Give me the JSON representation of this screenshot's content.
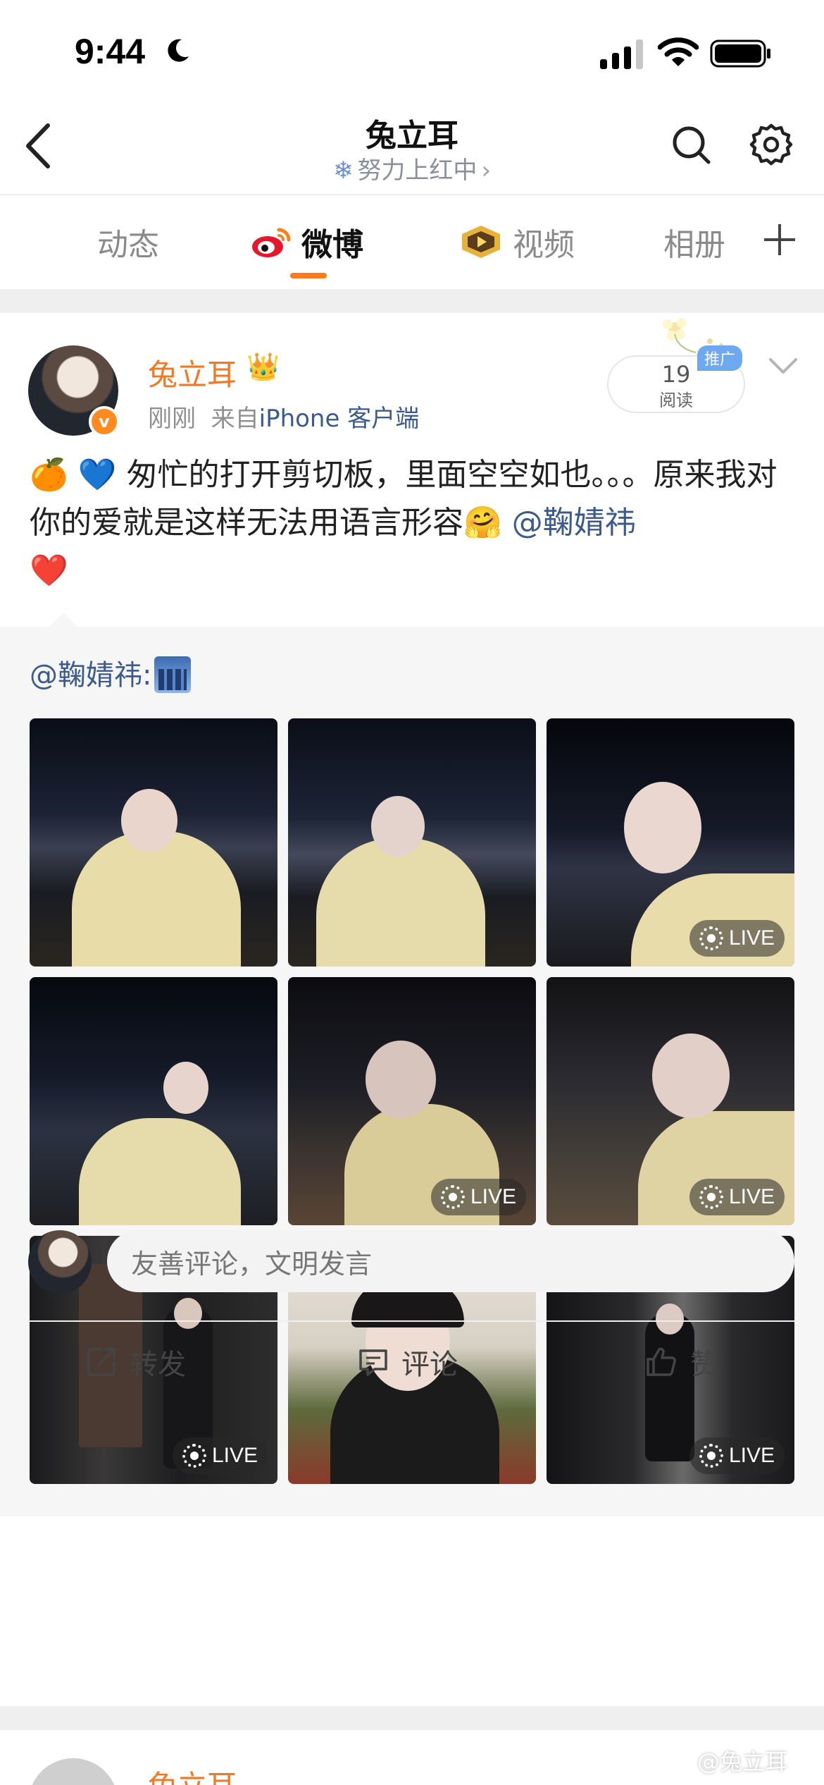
{
  "status_bar": {
    "time": "9:44"
  },
  "header": {
    "title": "兔立耳",
    "subtitle": "努力上红中",
    "subtitle_arrow": "›"
  },
  "tabs": [
    {
      "label": "动态",
      "active": false
    },
    {
      "label": "微博",
      "active": true
    },
    {
      "label": "视频",
      "active": false
    },
    {
      "label": "相册",
      "active": false
    }
  ],
  "post": {
    "username": "兔立耳",
    "time": "刚刚",
    "source_prefix": "来自",
    "source_client": "iPhone 客户端",
    "read_count": "19",
    "read_label": "阅读",
    "promo_tag": "推广",
    "text_emoji_start": "🍊 💙",
    "text_main": "匆忙的打开剪切板，里面空空如也。。。原来我对你的爱就是这样无法用语言形容",
    "text_emoji_mid": "🤗",
    "text_mention": "@鞠婧祎",
    "text_emoji_end": "❤️",
    "repost_line": "@鞠婧祎:",
    "live_label": "LIVE",
    "photos": [
      {
        "live": false
      },
      {
        "live": false
      },
      {
        "live": true
      },
      {
        "live": false
      },
      {
        "live": true
      },
      {
        "live": true
      },
      {
        "live": true
      },
      {
        "live": false
      },
      {
        "live": true
      }
    ]
  },
  "comment": {
    "placeholder": "友善评论，文明发言"
  },
  "actions": {
    "repost": "转发",
    "comment": "评论",
    "like": "赞"
  },
  "next_post": {
    "username": "兔立耳"
  },
  "watermark": "@兔立耳",
  "colors": {
    "accent": "#f07a23",
    "link": "#3b5b8c",
    "tab_indicator": "#ff7a1a"
  }
}
